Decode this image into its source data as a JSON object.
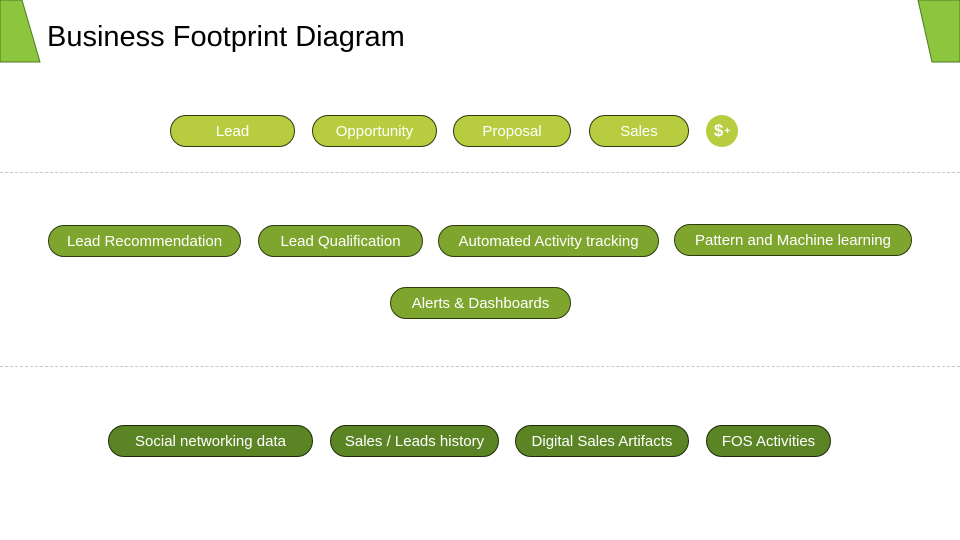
{
  "title": "Business Footprint Diagram",
  "colors": {
    "corner": "#8cc63f",
    "stage": "#b7cc3e",
    "feature": "#7ea62e",
    "source": "#5b8424",
    "divider": "#c9c9c9"
  },
  "stages": [
    "Lead",
    "Opportunity",
    "Proposal",
    "Sales"
  ],
  "stage_icon": "dollar-plus-icon",
  "features": [
    "Lead Recommendation",
    "Lead Qualification",
    "Automated Activity tracking",
    "Pattern and Machine learning",
    "Alerts & Dashboards"
  ],
  "sources": [
    "Social networking data",
    "Sales / Leads history",
    "Digital Sales Artifacts",
    "FOS Activities"
  ]
}
